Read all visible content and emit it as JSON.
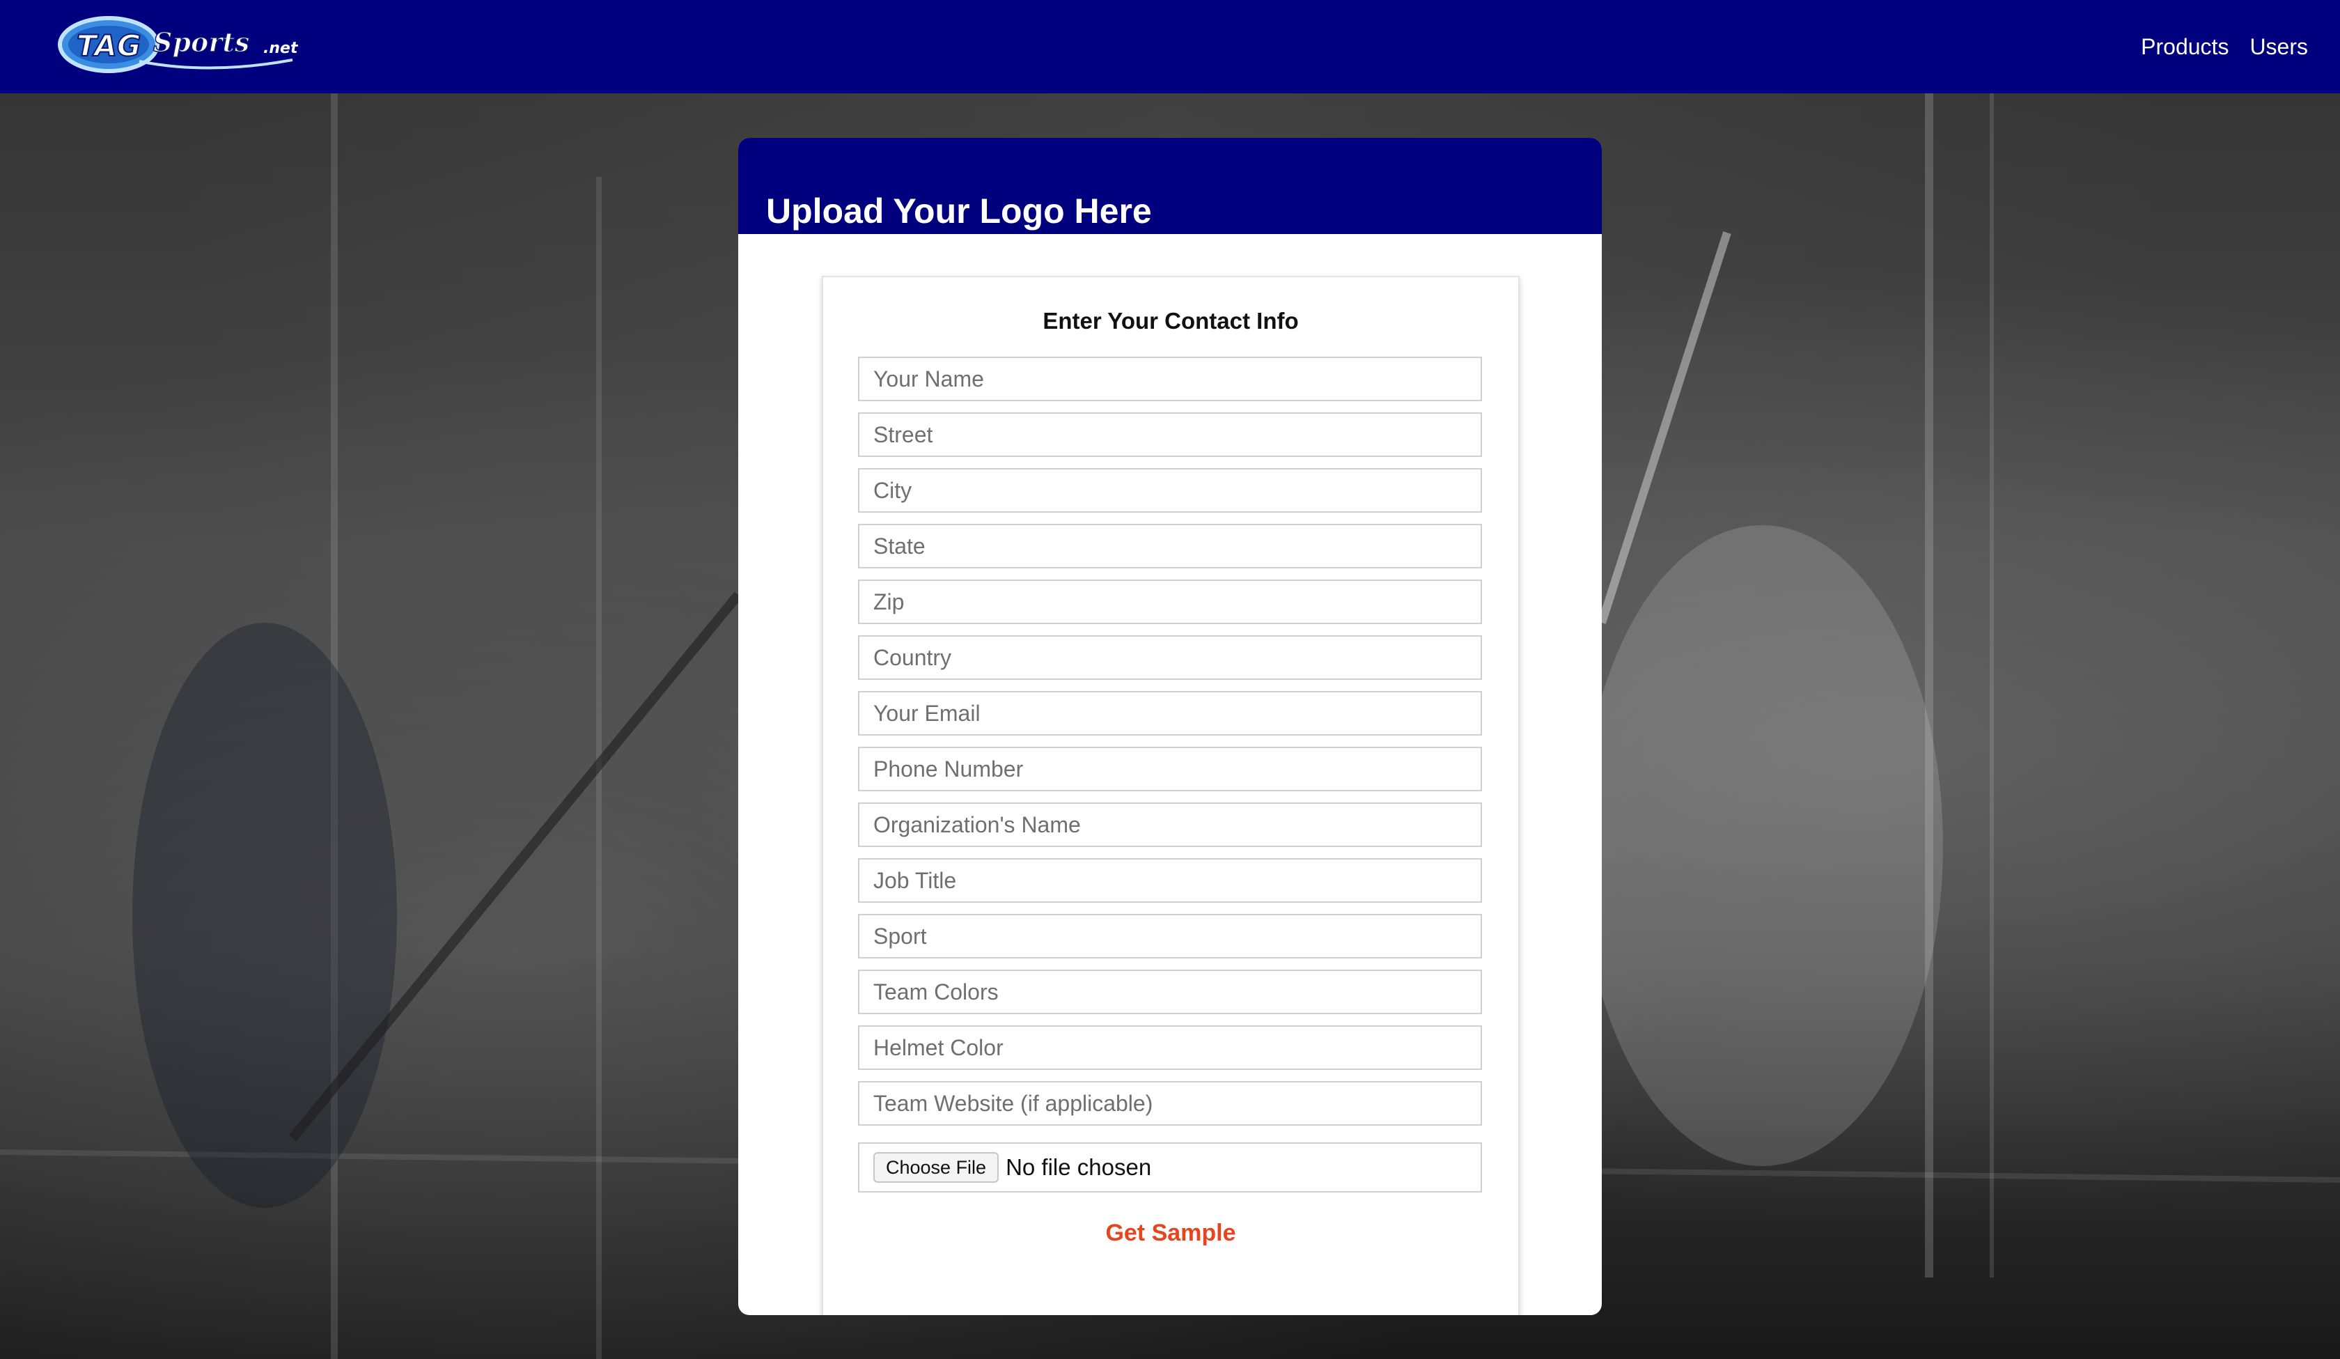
{
  "nav": {
    "logo_text_tag": "TAG",
    "logo_text_sports": "Sports",
    "logo_text_net": ".net",
    "links": [
      {
        "label": "Products"
      },
      {
        "label": "Users"
      }
    ],
    "bar_color": "#00007e"
  },
  "card": {
    "title": "Upload Your Logo Here"
  },
  "form": {
    "heading": "Enter Your Contact Info",
    "fields": [
      {
        "placeholder": "Your Name",
        "value": ""
      },
      {
        "placeholder": "Street",
        "value": ""
      },
      {
        "placeholder": "City",
        "value": ""
      },
      {
        "placeholder": "State",
        "value": ""
      },
      {
        "placeholder": "Zip",
        "value": ""
      },
      {
        "placeholder": "Country",
        "value": ""
      },
      {
        "placeholder": "Your Email",
        "value": ""
      },
      {
        "placeholder": "Phone Number",
        "value": ""
      },
      {
        "placeholder": "Organization's Name",
        "value": ""
      },
      {
        "placeholder": "Job Title",
        "value": ""
      },
      {
        "placeholder": "Sport",
        "value": ""
      },
      {
        "placeholder": "Team Colors",
        "value": ""
      },
      {
        "placeholder": "Helmet Color",
        "value": ""
      },
      {
        "placeholder": "Team Website (if applicable)",
        "value": ""
      }
    ],
    "file_upload": {
      "button_label": "Choose File",
      "status": "No file chosen"
    },
    "submit_label": "Get Sample",
    "submit_color": "#e8451f"
  }
}
